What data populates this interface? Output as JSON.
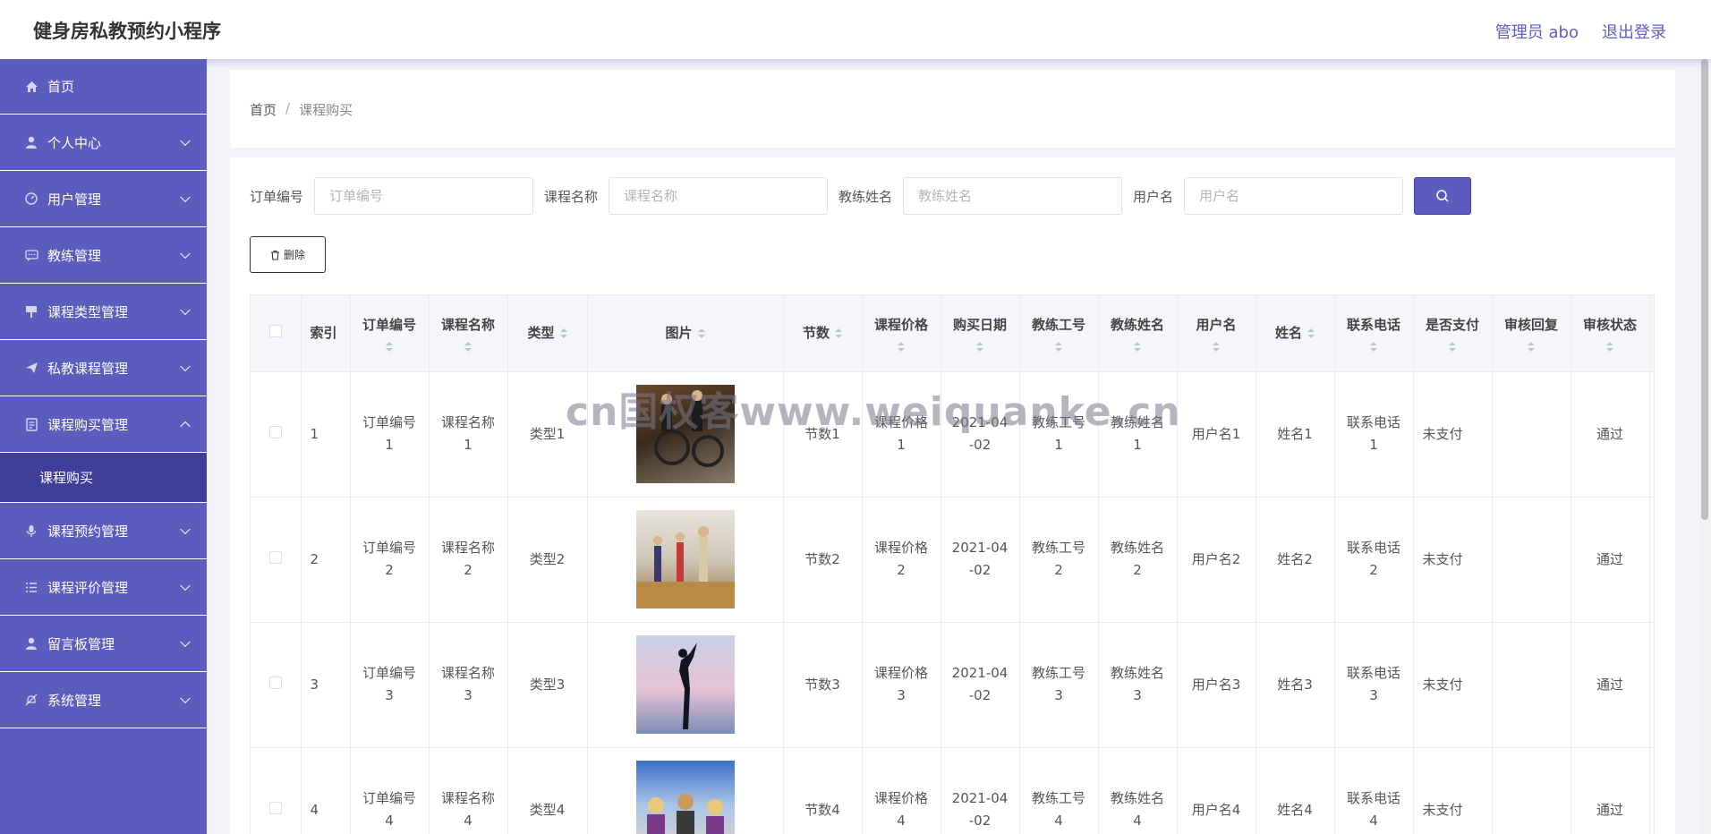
{
  "app": {
    "title": "健身房私教预约小程序"
  },
  "header": {
    "user_label": "管理员 abo",
    "logout_label": "退出登录"
  },
  "sidebar": {
    "items": [
      {
        "label": "首页",
        "icon": "home-icon",
        "expandable": false
      },
      {
        "label": "个人中心",
        "icon": "user-icon",
        "expandable": true
      },
      {
        "label": "用户管理",
        "icon": "gauge-icon",
        "expandable": true
      },
      {
        "label": "教练管理",
        "icon": "chat-icon",
        "expandable": true
      },
      {
        "label": "课程类型管理",
        "icon": "board-icon",
        "expandable": true
      },
      {
        "label": "私教课程管理",
        "icon": "send-icon",
        "expandable": true
      },
      {
        "label": "课程购买管理",
        "icon": "document-icon",
        "expandable": true,
        "expanded": true,
        "sub": [
          "课程购买"
        ]
      },
      {
        "label": "课程预约管理",
        "icon": "mic-icon",
        "expandable": true
      },
      {
        "label": "课程评价管理",
        "icon": "list-icon",
        "expandable": true
      },
      {
        "label": "留言板管理",
        "icon": "person-icon",
        "expandable": true
      },
      {
        "label": "系统管理",
        "icon": "bell-off-icon",
        "expandable": true
      }
    ]
  },
  "breadcrumb": {
    "home": "首页",
    "separator": "/",
    "current": "课程购买"
  },
  "search": {
    "order_no_label": "订单编号",
    "order_no_placeholder": "订单编号",
    "course_name_label": "课程名称",
    "course_name_placeholder": "课程名称",
    "coach_name_label": "教练姓名",
    "coach_name_placeholder": "教练姓名",
    "username_label": "用户名",
    "username_placeholder": "用户名"
  },
  "toolbar": {
    "delete_label": "删除"
  },
  "table": {
    "columns": [
      "索引",
      "订单编号",
      "课程名称",
      "类型",
      "图片",
      "节数",
      "课程价格",
      "购买日期",
      "教练工号",
      "教练姓名",
      "用户名",
      "姓名",
      "联系电话",
      "是否支付",
      "审核回复",
      "审核状态"
    ],
    "rows": [
      {
        "index": "1",
        "order_no": "订单编号1",
        "course_name": "课程名称1",
        "type": "类型1",
        "sessions": "节数1",
        "price": "课程价格1",
        "date": "2021-04-02",
        "coach_id": "教练工号1",
        "coach_name": "教练姓名1",
        "username": "用户名1",
        "name": "姓名1",
        "phone": "联系电话1",
        "paid": "未支付",
        "reply": "",
        "status": "通过"
      },
      {
        "index": "2",
        "order_no": "订单编号2",
        "course_name": "课程名称2",
        "type": "类型2",
        "sessions": "节数2",
        "price": "课程价格2",
        "date": "2021-04-02",
        "coach_id": "教练工号2",
        "coach_name": "教练姓名2",
        "username": "用户名2",
        "name": "姓名2",
        "phone": "联系电话2",
        "paid": "未支付",
        "reply": "",
        "status": "通过"
      },
      {
        "index": "3",
        "order_no": "订单编号3",
        "course_name": "课程名称3",
        "type": "类型3",
        "sessions": "节数3",
        "price": "课程价格3",
        "date": "2021-04-02",
        "coach_id": "教练工号3",
        "coach_name": "教练姓名3",
        "username": "用户名3",
        "name": "姓名3",
        "phone": "联系电话3",
        "paid": "未支付",
        "reply": "",
        "status": "通过"
      },
      {
        "index": "4",
        "order_no": "订单编号4",
        "course_name": "课程名称4",
        "type": "类型4",
        "sessions": "节数4",
        "price": "课程价格4",
        "date": "2021-04-02",
        "coach_id": "教练工号4",
        "coach_name": "教练姓名4",
        "username": "用户名4",
        "name": "姓名4",
        "phone": "联系电话4",
        "paid": "未支付",
        "reply": "",
        "status": "通过"
      }
    ]
  },
  "watermark": "cn国权客www.weiquanke.cn",
  "colors": {
    "accent": "#5b5cbd",
    "submenu_active": "#3f3f9a"
  }
}
